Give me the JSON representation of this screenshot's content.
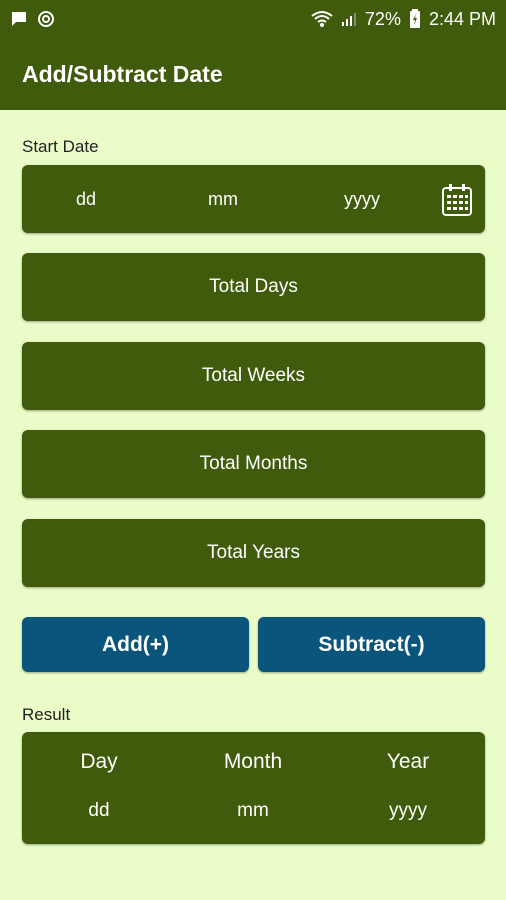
{
  "status_bar": {
    "battery_percent": "72%",
    "time": "2:44 PM",
    "icons": [
      "chat-icon",
      "sync-icon",
      "wifi-icon",
      "signal-icon",
      "battery-icon"
    ]
  },
  "app_bar": {
    "title": "Add/Subtract Date"
  },
  "start_date": {
    "label": "Start Date",
    "dd": "dd",
    "mm": "mm",
    "yyyy": "yyyy",
    "calendar_icon": "calendar-icon"
  },
  "fields": {
    "total_days": "Total Days",
    "total_weeks": "Total Weeks",
    "total_months": "Total Months",
    "total_years": "Total Years"
  },
  "buttons": {
    "add": "Add(+)",
    "subtract": "Subtract(-)"
  },
  "result": {
    "label": "Result",
    "day_header": "Day",
    "month_header": "Month",
    "year_header": "Year",
    "dd": "dd",
    "mm": "mm",
    "yyyy": "yyyy"
  },
  "colors": {
    "background": "#eafcc8",
    "primary": "#3f5b0b",
    "button": "#0a557b"
  }
}
